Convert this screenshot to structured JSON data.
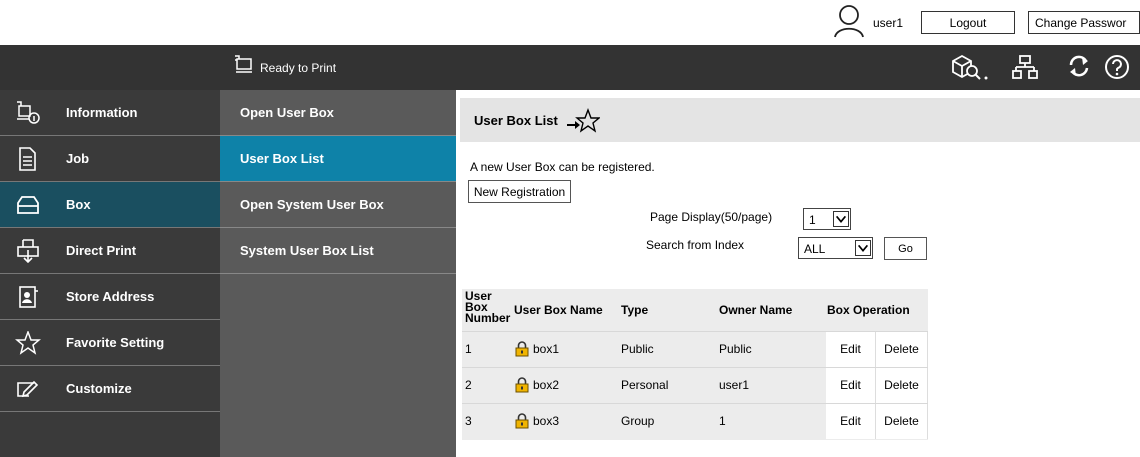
{
  "header": {
    "user_name": "user1",
    "logout_label": "Logout",
    "change_password_label": "Change Passwor"
  },
  "status": {
    "text": "Ready to Print"
  },
  "nav": {
    "items": [
      {
        "label": "Information",
        "icon": "information-icon"
      },
      {
        "label": "Job",
        "icon": "job-icon"
      },
      {
        "label": "Box",
        "icon": "box-icon",
        "active": true
      },
      {
        "label": "Direct Print",
        "icon": "direct-print-icon"
      },
      {
        "label": "Store Address",
        "icon": "store-address-icon"
      },
      {
        "label": "Favorite Setting",
        "icon": "star-icon"
      },
      {
        "label": "Customize",
        "icon": "customize-icon"
      }
    ]
  },
  "subnav": {
    "items": [
      {
        "label": "Open User Box"
      },
      {
        "label": "User Box List",
        "active": true
      },
      {
        "label": "Open System User Box"
      },
      {
        "label": "System User Box List"
      }
    ]
  },
  "main": {
    "title": "User Box List",
    "message": "A new User Box can be registered.",
    "new_registration_label": "New Registration",
    "page_display_label": "Page Display(50/page)",
    "page_value": "1",
    "search_label": "Search from Index",
    "index_value": "ALL",
    "go_label": "Go"
  },
  "table": {
    "headers": {
      "number_line1": "User",
      "number_line2": "Box",
      "number_line3": "Number",
      "name": "User Box Name",
      "type": "Type",
      "owner": "Owner Name",
      "operation": "Box Operation"
    },
    "rows": [
      {
        "number": "1",
        "name": "box1",
        "type": "Public",
        "owner": "Public",
        "edit": "Edit",
        "delete": "Delete"
      },
      {
        "number": "2",
        "name": "box2",
        "type": "Personal",
        "owner": "user1",
        "edit": "Edit",
        "delete": "Delete"
      },
      {
        "number": "3",
        "name": "box3",
        "type": "Group",
        "owner": "1",
        "edit": "Edit",
        "delete": "Delete"
      }
    ]
  },
  "colors": {
    "status_bar": "#333333",
    "nav_background": "#3a3a3a",
    "nav_active": "#1a4f60",
    "subnav_background": "#5a5a5a",
    "subnav_active": "#0e82a8",
    "lock": "#f0b400"
  }
}
